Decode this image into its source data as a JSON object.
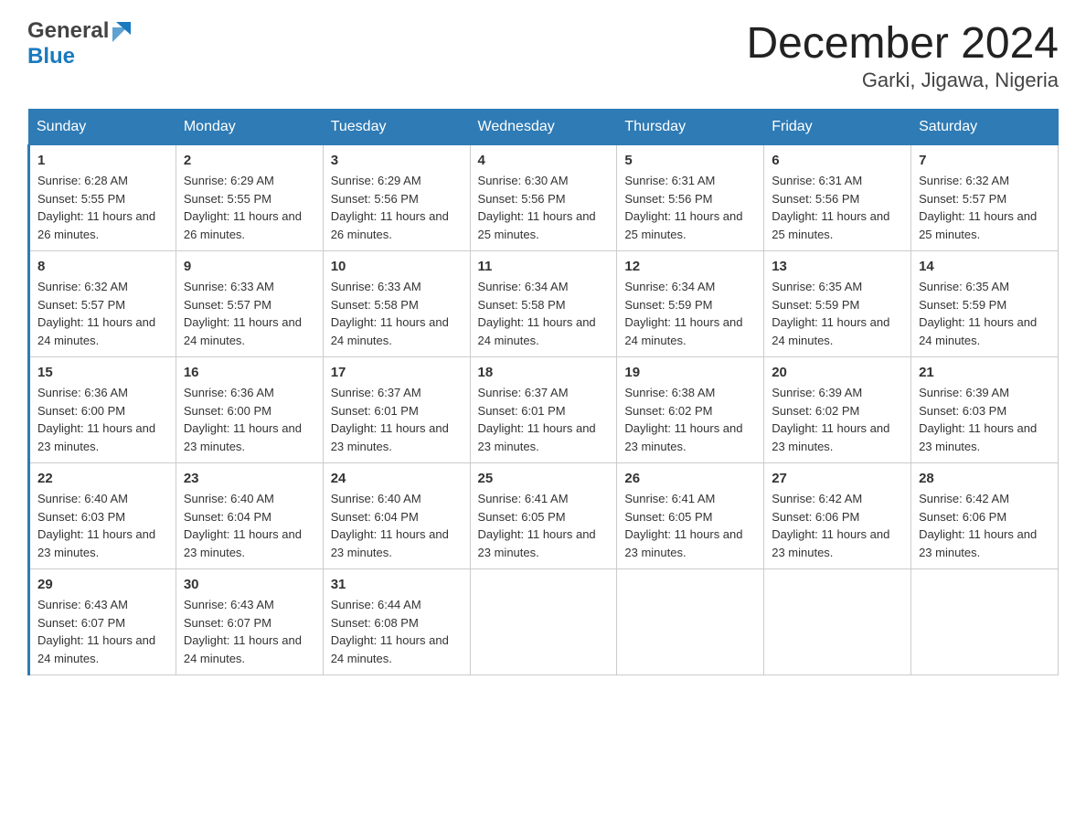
{
  "header": {
    "title": "December 2024",
    "subtitle": "Garki, Jigawa, Nigeria",
    "logo_general": "General",
    "logo_blue": "Blue"
  },
  "calendar": {
    "days_of_week": [
      "Sunday",
      "Monday",
      "Tuesday",
      "Wednesday",
      "Thursday",
      "Friday",
      "Saturday"
    ],
    "weeks": [
      [
        {
          "date": "1",
          "sunrise": "6:28 AM",
          "sunset": "5:55 PM",
          "daylight": "11 hours and 26 minutes."
        },
        {
          "date": "2",
          "sunrise": "6:29 AM",
          "sunset": "5:55 PM",
          "daylight": "11 hours and 26 minutes."
        },
        {
          "date": "3",
          "sunrise": "6:29 AM",
          "sunset": "5:56 PM",
          "daylight": "11 hours and 26 minutes."
        },
        {
          "date": "4",
          "sunrise": "6:30 AM",
          "sunset": "5:56 PM",
          "daylight": "11 hours and 25 minutes."
        },
        {
          "date": "5",
          "sunrise": "6:31 AM",
          "sunset": "5:56 PM",
          "daylight": "11 hours and 25 minutes."
        },
        {
          "date": "6",
          "sunrise": "6:31 AM",
          "sunset": "5:56 PM",
          "daylight": "11 hours and 25 minutes."
        },
        {
          "date": "7",
          "sunrise": "6:32 AM",
          "sunset": "5:57 PM",
          "daylight": "11 hours and 25 minutes."
        }
      ],
      [
        {
          "date": "8",
          "sunrise": "6:32 AM",
          "sunset": "5:57 PM",
          "daylight": "11 hours and 24 minutes."
        },
        {
          "date": "9",
          "sunrise": "6:33 AM",
          "sunset": "5:57 PM",
          "daylight": "11 hours and 24 minutes."
        },
        {
          "date": "10",
          "sunrise": "6:33 AM",
          "sunset": "5:58 PM",
          "daylight": "11 hours and 24 minutes."
        },
        {
          "date": "11",
          "sunrise": "6:34 AM",
          "sunset": "5:58 PM",
          "daylight": "11 hours and 24 minutes."
        },
        {
          "date": "12",
          "sunrise": "6:34 AM",
          "sunset": "5:59 PM",
          "daylight": "11 hours and 24 minutes."
        },
        {
          "date": "13",
          "sunrise": "6:35 AM",
          "sunset": "5:59 PM",
          "daylight": "11 hours and 24 minutes."
        },
        {
          "date": "14",
          "sunrise": "6:35 AM",
          "sunset": "5:59 PM",
          "daylight": "11 hours and 24 minutes."
        }
      ],
      [
        {
          "date": "15",
          "sunrise": "6:36 AM",
          "sunset": "6:00 PM",
          "daylight": "11 hours and 23 minutes."
        },
        {
          "date": "16",
          "sunrise": "6:36 AM",
          "sunset": "6:00 PM",
          "daylight": "11 hours and 23 minutes."
        },
        {
          "date": "17",
          "sunrise": "6:37 AM",
          "sunset": "6:01 PM",
          "daylight": "11 hours and 23 minutes."
        },
        {
          "date": "18",
          "sunrise": "6:37 AM",
          "sunset": "6:01 PM",
          "daylight": "11 hours and 23 minutes."
        },
        {
          "date": "19",
          "sunrise": "6:38 AM",
          "sunset": "6:02 PM",
          "daylight": "11 hours and 23 minutes."
        },
        {
          "date": "20",
          "sunrise": "6:39 AM",
          "sunset": "6:02 PM",
          "daylight": "11 hours and 23 minutes."
        },
        {
          "date": "21",
          "sunrise": "6:39 AM",
          "sunset": "6:03 PM",
          "daylight": "11 hours and 23 minutes."
        }
      ],
      [
        {
          "date": "22",
          "sunrise": "6:40 AM",
          "sunset": "6:03 PM",
          "daylight": "11 hours and 23 minutes."
        },
        {
          "date": "23",
          "sunrise": "6:40 AM",
          "sunset": "6:04 PM",
          "daylight": "11 hours and 23 minutes."
        },
        {
          "date": "24",
          "sunrise": "6:40 AM",
          "sunset": "6:04 PM",
          "daylight": "11 hours and 23 minutes."
        },
        {
          "date": "25",
          "sunrise": "6:41 AM",
          "sunset": "6:05 PM",
          "daylight": "11 hours and 23 minutes."
        },
        {
          "date": "26",
          "sunrise": "6:41 AM",
          "sunset": "6:05 PM",
          "daylight": "11 hours and 23 minutes."
        },
        {
          "date": "27",
          "sunrise": "6:42 AM",
          "sunset": "6:06 PM",
          "daylight": "11 hours and 23 minutes."
        },
        {
          "date": "28",
          "sunrise": "6:42 AM",
          "sunset": "6:06 PM",
          "daylight": "11 hours and 23 minutes."
        }
      ],
      [
        {
          "date": "29",
          "sunrise": "6:43 AM",
          "sunset": "6:07 PM",
          "daylight": "11 hours and 24 minutes."
        },
        {
          "date": "30",
          "sunrise": "6:43 AM",
          "sunset": "6:07 PM",
          "daylight": "11 hours and 24 minutes."
        },
        {
          "date": "31",
          "sunrise": "6:44 AM",
          "sunset": "6:08 PM",
          "daylight": "11 hours and 24 minutes."
        },
        null,
        null,
        null,
        null
      ]
    ]
  }
}
